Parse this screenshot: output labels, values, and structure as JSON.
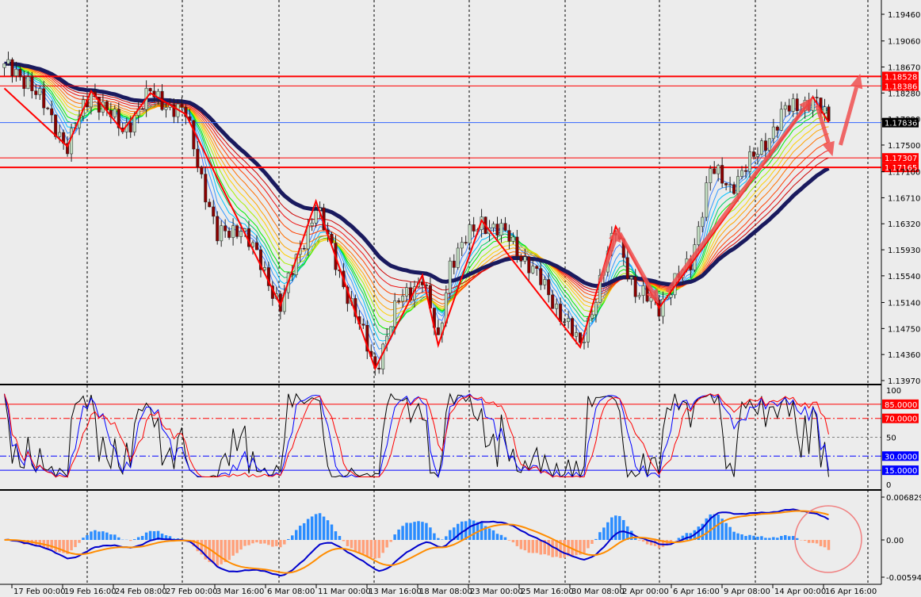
{
  "colors": {
    "background": "#ececec",
    "bull_candle": "#c0dcc0",
    "bear_candle": "#8b0000",
    "candle_outline": "#222222",
    "slow_ma": "#1a1a5e",
    "zigzag": "#ff0000",
    "arrow": "#f05050",
    "level_red": "#ff0000",
    "level_blue": "#0000ff",
    "current_price": "#3366ff",
    "macd_pos": "#2a8cff",
    "macd_neg": "#ffa07a",
    "macd_line": "#0000cc",
    "signal_line": "#ff8c00",
    "highlight_circle": "#f08080"
  },
  "chart_data": {
    "type": "candlestick",
    "price_axis": {
      "ylim": [
        1.1397,
        1.1946
      ],
      "ticks": [
        "1.19460",
        "1.19060",
        "1.18670",
        "1.18280",
        "1.17890",
        "1.17500",
        "1.17100",
        "1.16710",
        "1.16320",
        "1.15930",
        "1.15540",
        "1.15140",
        "1.14750",
        "1.14360",
        "1.13970"
      ],
      "tick_values": [
        1.1946,
        1.1906,
        1.1867,
        1.1828,
        1.1789,
        1.175,
        1.171,
        1.1671,
        1.1632,
        1.1593,
        1.1554,
        1.1514,
        1.1475,
        1.1436,
        1.1397
      ]
    },
    "time_axis": {
      "labels": [
        "17 Feb 00:00",
        "19 Feb 16:00",
        "24 Feb 08:00",
        "27 Feb 00:00",
        "3 Mar 16:00",
        "6 Mar 08:00",
        "11 Mar 00:00",
        "13 Mar 16:00",
        "18 Mar 08:00",
        "23 Mar 00:00",
        "25 Mar 16:00",
        "30 Mar 08:00",
        "2 Apr 00:00",
        "6 Apr 16:00",
        "9 Apr 08:00",
        "14 Apr 00:00",
        "16 Apr 16:00"
      ],
      "bars": 210
    },
    "price_path": [
      {
        "bar": 0,
        "price": 1.1866
      },
      {
        "bar": 6,
        "price": 1.1848
      },
      {
        "bar": 16,
        "price": 1.1748
      },
      {
        "bar": 22,
        "price": 1.1831
      },
      {
        "bar": 30,
        "price": 1.1771
      },
      {
        "bar": 37,
        "price": 1.1827
      },
      {
        "bar": 46,
        "price": 1.1795
      },
      {
        "bar": 54,
        "price": 1.1611
      },
      {
        "bar": 60,
        "price": 1.1629
      },
      {
        "bar": 70,
        "price": 1.151
      },
      {
        "bar": 79,
        "price": 1.1659
      },
      {
        "bar": 84,
        "price": 1.1575
      },
      {
        "bar": 94,
        "price": 1.1415
      },
      {
        "bar": 100,
        "price": 1.1516
      },
      {
        "bar": 106,
        "price": 1.1552
      },
      {
        "bar": 110,
        "price": 1.1451
      },
      {
        "bar": 113,
        "price": 1.1575
      },
      {
        "bar": 121,
        "price": 1.1637
      },
      {
        "bar": 128,
        "price": 1.1611
      },
      {
        "bar": 138,
        "price": 1.1528
      },
      {
        "bar": 146,
        "price": 1.1447
      },
      {
        "bar": 155,
        "price": 1.1623
      },
      {
        "bar": 160,
        "price": 1.1528
      },
      {
        "bar": 166,
        "price": 1.151
      },
      {
        "bar": 174,
        "price": 1.1575
      },
      {
        "bar": 179,
        "price": 1.1712
      },
      {
        "bar": 184,
        "price": 1.1688
      },
      {
        "bar": 190,
        "price": 1.173
      },
      {
        "bar": 198,
        "price": 1.1801
      },
      {
        "bar": 205,
        "price": 1.1819
      },
      {
        "bar": 209,
        "price": 1.1784
      }
    ],
    "zigzag": [
      {
        "bar": 0,
        "price": 1.1835
      },
      {
        "bar": 16,
        "price": 1.1748
      },
      {
        "bar": 22,
        "price": 1.1831
      },
      {
        "bar": 30,
        "price": 1.1771
      },
      {
        "bar": 37,
        "price": 1.1828
      },
      {
        "bar": 46,
        "price": 1.1796
      },
      {
        "bar": 70,
        "price": 1.151
      },
      {
        "bar": 79,
        "price": 1.1666
      },
      {
        "bar": 94,
        "price": 1.1415
      },
      {
        "bar": 106,
        "price": 1.1555
      },
      {
        "bar": 110,
        "price": 1.145
      },
      {
        "bar": 121,
        "price": 1.1637
      },
      {
        "bar": 146,
        "price": 1.1447
      },
      {
        "bar": 155,
        "price": 1.1628
      },
      {
        "bar": 166,
        "price": 1.1506
      },
      {
        "bar": 205,
        "price": 1.1822
      },
      {
        "bar": 209,
        "price": 1.1784
      }
    ],
    "arrows": [
      {
        "from": {
          "bar": 151,
          "price": 1.1545
        },
        "to": {
          "bar": 156,
          "price": 1.1627
        }
      },
      {
        "from": {
          "bar": 156,
          "price": 1.1618
        },
        "to": {
          "bar": 166,
          "price": 1.1512
        }
      },
      {
        "from": {
          "bar": 168,
          "price": 1.153
        },
        "to": {
          "bar": 205,
          "price": 1.1822
        }
      },
      {
        "from": {
          "bar": 206,
          "price": 1.181
        },
        "to": {
          "bar": 210,
          "price": 1.1733
        }
      },
      {
        "from": {
          "bar": 212,
          "price": 1.175
        },
        "to": {
          "bar": 217,
          "price": 1.1857
        }
      }
    ],
    "levels": [
      {
        "price": 1.18528,
        "label": "1.18528",
        "color": "#ff0000",
        "thick": true
      },
      {
        "price": 1.18386,
        "label": "1.18386",
        "color": "#ff0000",
        "thick": false
      },
      {
        "price": 1.17307,
        "label": "1.17307",
        "color": "#ff0000",
        "thick": false
      },
      {
        "price": 1.17165,
        "label": "1.17165",
        "color": "#ff0000",
        "thick": true
      }
    ],
    "current_price": {
      "price": 1.17836,
      "label": "1.17836"
    },
    "oscillator": {
      "ylim": [
        0,
        100
      ],
      "ticks": [
        "100",
        "50",
        "0"
      ],
      "levels": [
        {
          "value": 85,
          "label": "85.0000",
          "color": "#ff0000",
          "style": "solid"
        },
        {
          "value": 70,
          "label": "70.0000",
          "color": "#ff0000",
          "style": "dashdot"
        },
        {
          "value": 50,
          "label": "",
          "color": "#808080",
          "style": "dashed"
        },
        {
          "value": 30,
          "label": "30.0000",
          "color": "#0000ff",
          "style": "dashdot"
        },
        {
          "value": 15,
          "label": "15.0000",
          "color": "#0000ff",
          "style": "solid"
        }
      ],
      "series_colors": [
        "#000000",
        "#0000ff",
        "#ff0000"
      ]
    },
    "macd": {
      "ylim": [
        -0.00594,
        0.0068298
      ],
      "ticks": [
        "0.0068298",
        "0.00",
        "-0.005940"
      ]
    },
    "grid": "vertical-dashed"
  }
}
